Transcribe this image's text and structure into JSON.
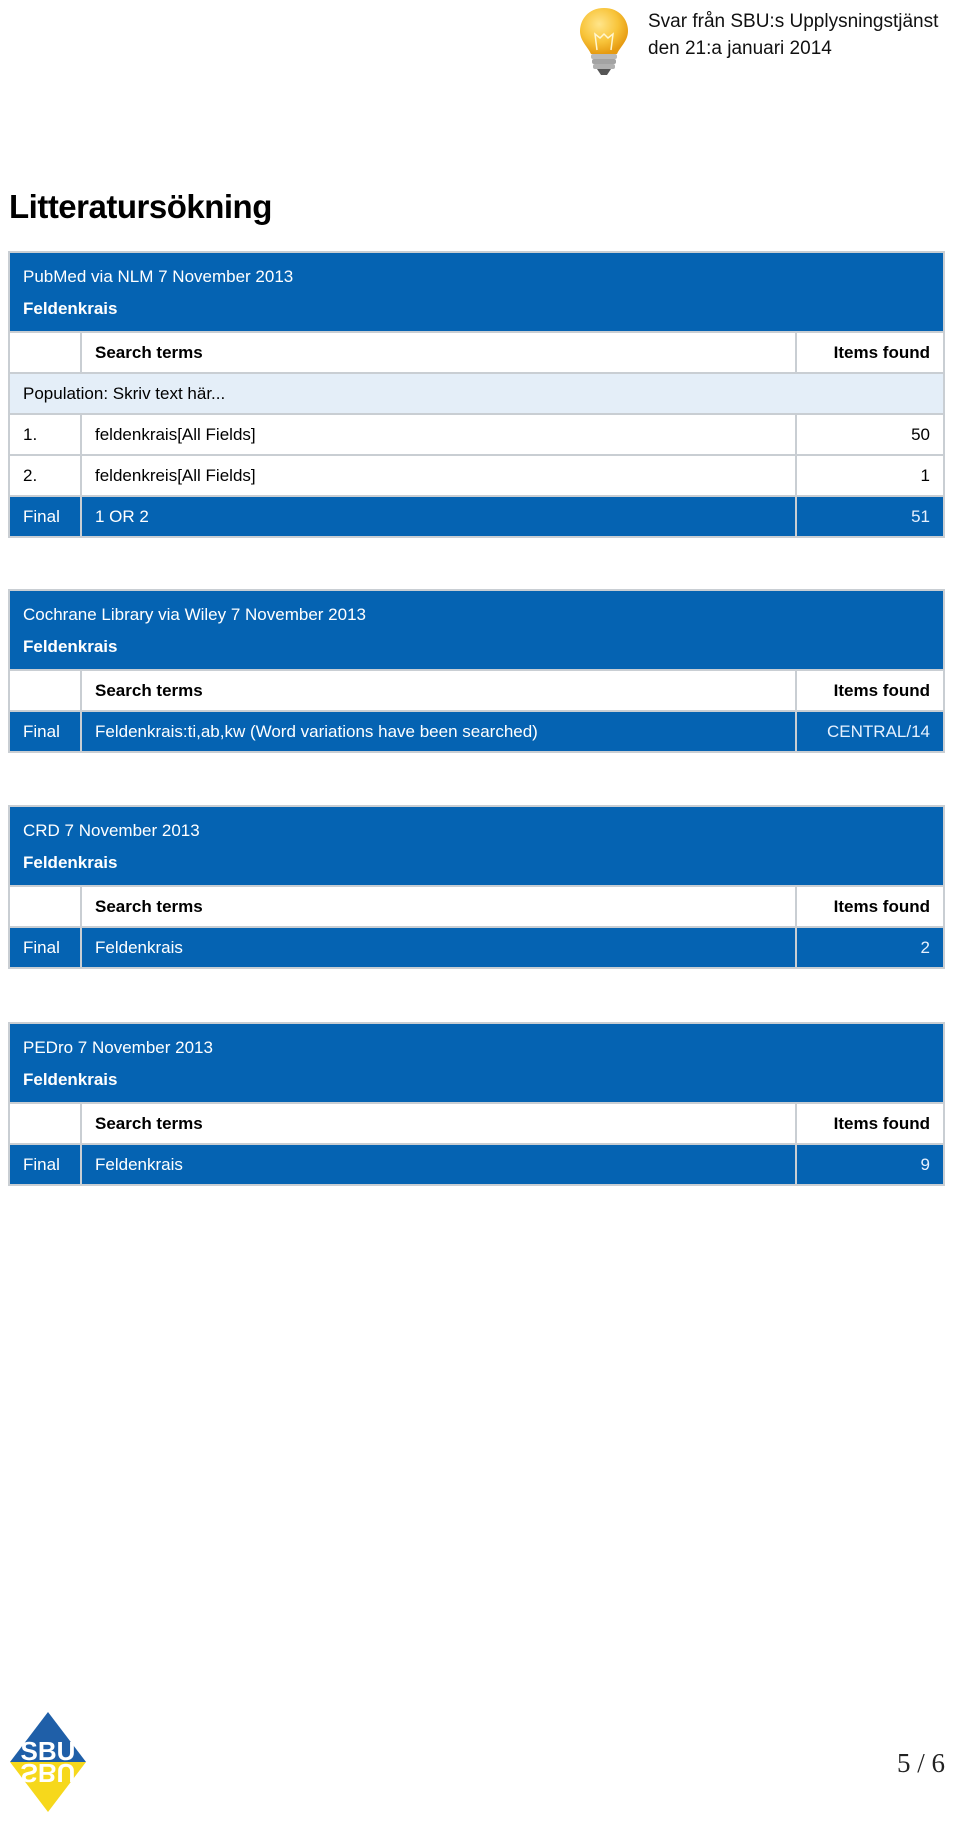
{
  "header": {
    "icon": "lightbulb-icon",
    "line1": "Svar från SBU:s Upplysningstjänst",
    "line2": "den 21:a januari 2014"
  },
  "title": "Litteratursökning",
  "tables": [
    {
      "database": "PubMed via NLM 7 November 2013",
      "topic": "Feldenkrais",
      "col_search": "Search terms",
      "col_items": "Items found",
      "population": "Population: Skriv text här...",
      "rows": [
        {
          "n": "1.",
          "term": "feldenkrais[All Fields]",
          "items": "50"
        },
        {
          "n": "2.",
          "term": "feldenkreis[All Fields]",
          "items": "1"
        }
      ],
      "final": {
        "label": "Final",
        "term": "1 OR 2",
        "items": "51"
      }
    },
    {
      "database": "Cochrane Library via Wiley 7 November 2013",
      "topic": "Feldenkrais",
      "col_search": "Search terms",
      "col_items": "Items found",
      "final": {
        "label": "Final",
        "term": "Feldenkrais:ti,ab,kw (Word variations have been searched)",
        "items": "CENTRAL/14"
      }
    },
    {
      "database": "CRD 7 November 2013",
      "topic": "Feldenkrais",
      "col_search": "Search terms",
      "col_items": "Items found",
      "final": {
        "label": "Final",
        "term": "Feldenkrais",
        "items": "2"
      }
    },
    {
      "database": "PEDro 7 November 2013",
      "topic": "Feldenkrais",
      "col_search": "Search terms",
      "col_items": "Items found",
      "final": {
        "label": "Final",
        "term": "Feldenkrais",
        "items": "9"
      }
    }
  ],
  "footer": {
    "logo": "SBU",
    "page": "5 / 6"
  },
  "colors": {
    "band_blue": "#0563b2",
    "population_bg": "#e4eef8",
    "border": "#c9ced3"
  }
}
